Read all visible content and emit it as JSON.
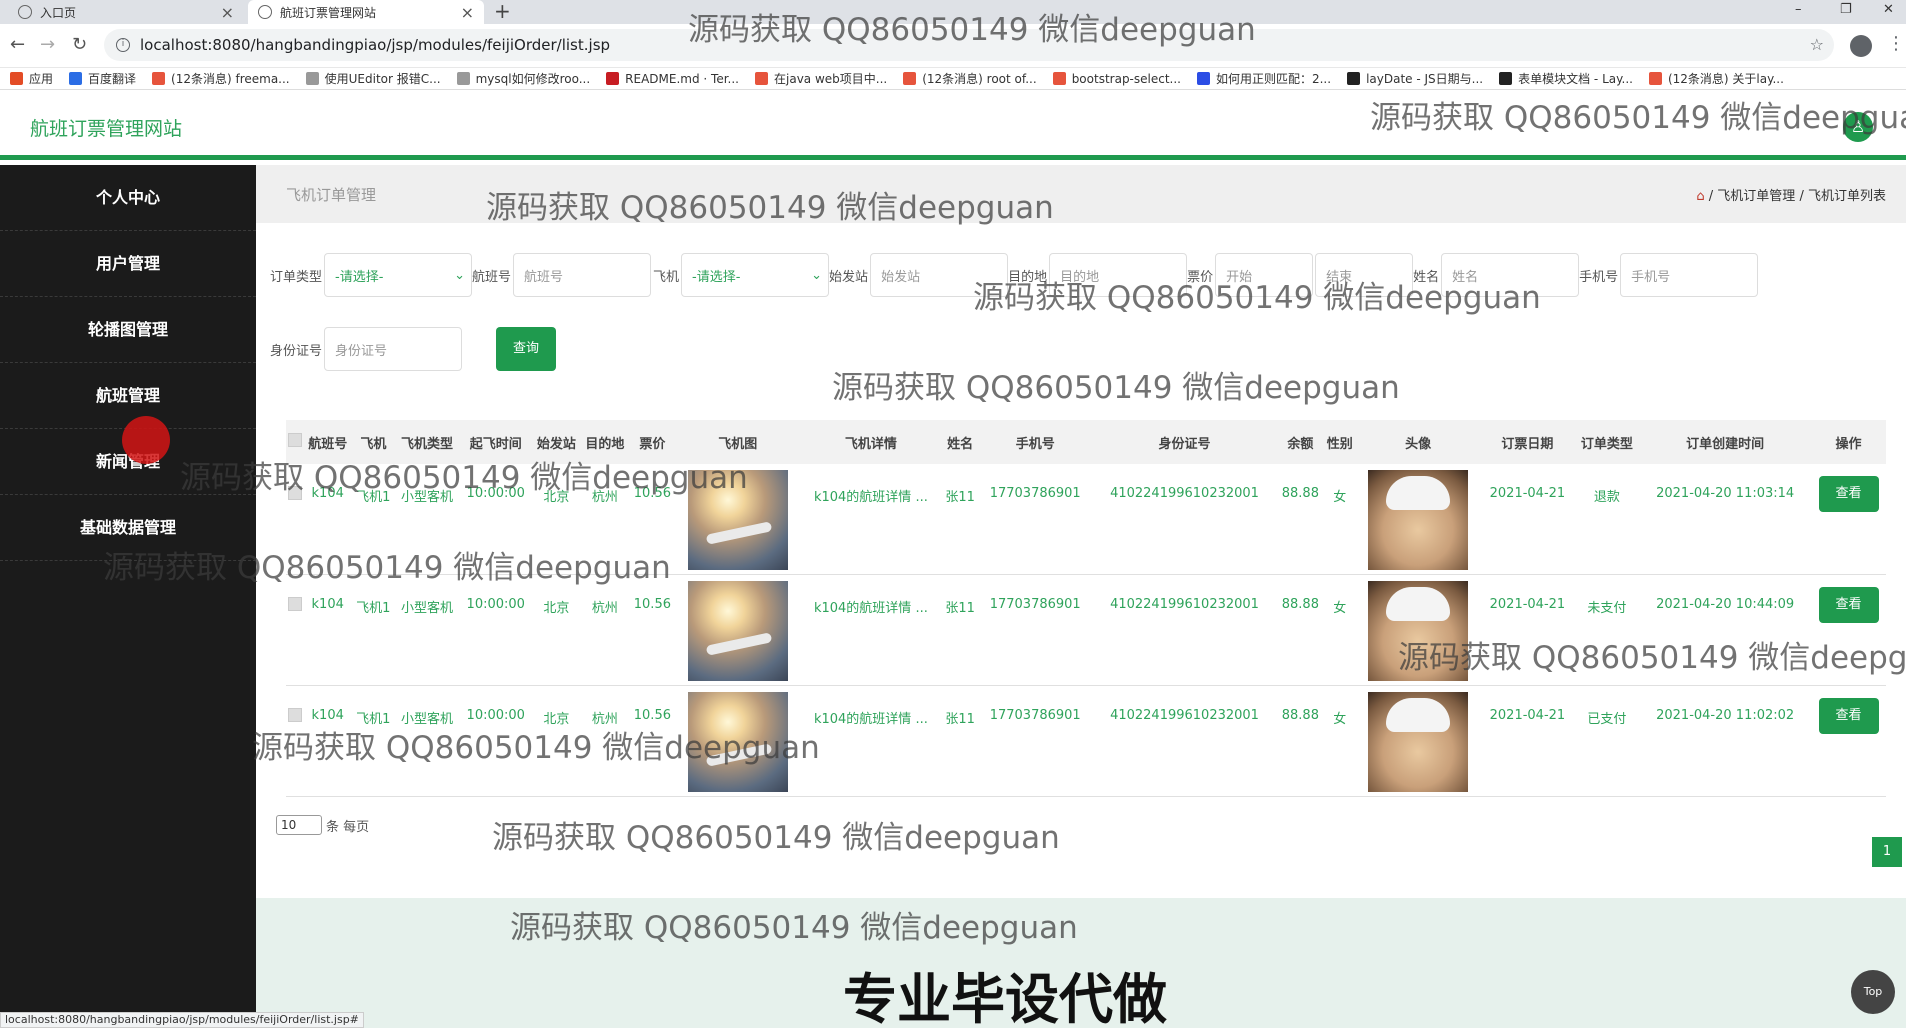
{
  "browser": {
    "tabs": [
      {
        "label": "入口页",
        "close": "×"
      },
      {
        "label": "航班订票管理网站",
        "close": "×"
      }
    ],
    "new_tab": "+",
    "window_controls": {
      "minimize": "–",
      "maximize": "❐",
      "close": "✕"
    },
    "url": "localhost:8080/hangbandingpiao/jsp/modules/feijiOrder/list.jsp",
    "bookmarks": [
      {
        "label": "应用",
        "color": "#e34c26"
      },
      {
        "label": "百度翻译",
        "color": "#2b6de5"
      },
      {
        "label": "(12条消息) freema...",
        "color": "#e6543c"
      },
      {
        "label": "使用UEditor 报错C...",
        "color": "#999999"
      },
      {
        "label": "mysql如何修改roo...",
        "color": "#999999"
      },
      {
        "label": "README.md · Ter...",
        "color": "#c71d23"
      },
      {
        "label": "在java web项目中...",
        "color": "#e6543c"
      },
      {
        "label": "(12条消息) root of...",
        "color": "#e6543c"
      },
      {
        "label": "bootstrap-select...",
        "color": "#e6543c"
      },
      {
        "label": "如何用正则匹配：2...",
        "color": "#2b4de5"
      },
      {
        "label": "layDate - JS日期与...",
        "color": "#222222"
      },
      {
        "label": "表单模块文档 - Lay...",
        "color": "#222222"
      },
      {
        "label": "(12条消息) 关于lay...",
        "color": "#e6543c"
      }
    ],
    "status_url": "localhost:8080/hangbandingpiao/jsp/modules/feijiOrder/list.jsp#"
  },
  "header": {
    "brand": "航班订票管理网站",
    "accent": "#1f9a4e"
  },
  "sidebar": {
    "items": [
      {
        "label": "个人中心"
      },
      {
        "label": "用户管理"
      },
      {
        "label": "轮播图管理"
      },
      {
        "label": "航班管理"
      },
      {
        "label": "新闻管理"
      },
      {
        "label": "基础数据管理"
      }
    ]
  },
  "page": {
    "title": "飞机订单管理",
    "breadcrumb": [
      "飞机订单管理",
      "飞机订单列表"
    ],
    "breadcrumb_sep": "/"
  },
  "filters": {
    "order_type": {
      "label": "订单类型",
      "value": "-请选择-"
    },
    "flight_no": {
      "label": "航班号",
      "placeholder": "航班号"
    },
    "plane": {
      "label": "飞机",
      "value": "-请选择-"
    },
    "origin": {
      "label": "始发站",
      "placeholder": "始发站"
    },
    "destination": {
      "label": "目的地",
      "placeholder": "目的地"
    },
    "price": {
      "label": "票价",
      "placeholder_start": "开始",
      "placeholder_end": "结束"
    },
    "name": {
      "label": "姓名",
      "placeholder": "姓名"
    },
    "phone": {
      "label": "手机号",
      "placeholder": "手机号"
    },
    "id_card": {
      "label": "身份证号",
      "placeholder": "身份证号"
    },
    "search_label": "查询"
  },
  "table": {
    "columns": [
      "航班号",
      "飞机",
      "飞机类型",
      "起飞时间",
      "始发站",
      "目的地",
      "票价",
      "飞机图",
      "飞机详情",
      "姓名",
      "手机号",
      "身份证号",
      "余额",
      "性别",
      "头像",
      "订票日期",
      "订单类型",
      "订单创建时间",
      "操作"
    ],
    "rows": [
      {
        "flight_no": "k104",
        "plane": "飞机1",
        "plane_type": "小型客机",
        "takeoff": "10:00:00",
        "origin": "北京",
        "destination": "杭州",
        "price": "10.56",
        "detail": "k104的航班详情 ...",
        "name": "张11",
        "phone": "17703786901",
        "id_card": "410224199610232001",
        "balance": "88.88",
        "gender": "女",
        "book_date": "2021-04-21",
        "order_type": "退款",
        "created": "2021-04-20 11:03:14",
        "action": "查看"
      },
      {
        "flight_no": "k104",
        "plane": "飞机1",
        "plane_type": "小型客机",
        "takeoff": "10:00:00",
        "origin": "北京",
        "destination": "杭州",
        "price": "10.56",
        "detail": "k104的航班详情 ...",
        "name": "张11",
        "phone": "17703786901",
        "id_card": "410224199610232001",
        "balance": "88.88",
        "gender": "女",
        "book_date": "2021-04-21",
        "order_type": "未支付",
        "created": "2021-04-20 10:44:09",
        "action": "查看"
      },
      {
        "flight_no": "k104",
        "plane": "飞机1",
        "plane_type": "小型客机",
        "takeoff": "10:00:00",
        "origin": "北京",
        "destination": "杭州",
        "price": "10.56",
        "detail": "k104的航班详情 ...",
        "name": "张11",
        "phone": "17703786901",
        "id_card": "410224199610232001",
        "balance": "88.88",
        "gender": "女",
        "book_date": "2021-04-21",
        "order_type": "已支付",
        "created": "2021-04-20 11:02:02",
        "action": "查看"
      }
    ]
  },
  "pagination": {
    "page_size": "10",
    "per_page_label": "条 每页",
    "current_page": "1"
  },
  "top_button": "Top",
  "watermark": "源码获取 QQ86050149 微信deepguan",
  "banner": "专业毕设代做"
}
